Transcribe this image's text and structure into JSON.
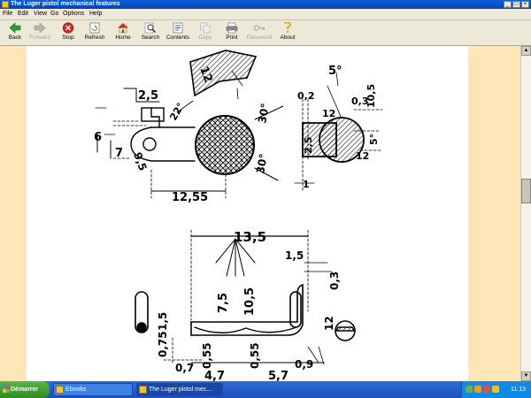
{
  "window": {
    "title": "The Luger pistol mechanical features"
  },
  "menu": [
    "File",
    "Edit",
    "View",
    "Go",
    "Options",
    "Help"
  ],
  "toolbar": {
    "back": "Back",
    "forward": "Forward",
    "stop": "Stop",
    "refresh": "Refresh",
    "home": "Home",
    "search": "Search",
    "contents": "Contents",
    "copy": "Copy",
    "print": "Print",
    "password": "Password",
    "about": "About"
  },
  "drawing": {
    "top": {
      "d12": "12",
      "d25": "2,5",
      "d22": "22°",
      "d6": "6",
      "d7": "7",
      "d95": "9,5",
      "d30a": "30°",
      "d30b": "30°",
      "d1255": "12,55",
      "d5deg": "5°",
      "d02": "0,2",
      "d12b": "12",
      "d03": "0,3",
      "d105": "10,5",
      "d25b": "2,5",
      "d5b": "5°",
      "d12c": "12",
      "d1": "1"
    },
    "bottom": {
      "d135": "13,5",
      "d15": "1,5",
      "d03": "0,3",
      "d75": "7,5",
      "d105": "10,5",
      "d15b": "1,5",
      "d12": "12",
      "d075": "0,75",
      "d055a": "0,55",
      "d055b": "0,55",
      "d07": "0,7",
      "d47": "4,7",
      "d57": "5,7",
      "d09": "0,9"
    }
  },
  "taskbar": {
    "start": "Démarrer",
    "tasks": [
      "Ebooks",
      "The Luger pistol mec..."
    ],
    "clock": "11:13"
  },
  "colors": {
    "titlebar": "#0a5fd8",
    "page_bg": "#fde7b8",
    "taskbar": "#2e6bd8"
  }
}
